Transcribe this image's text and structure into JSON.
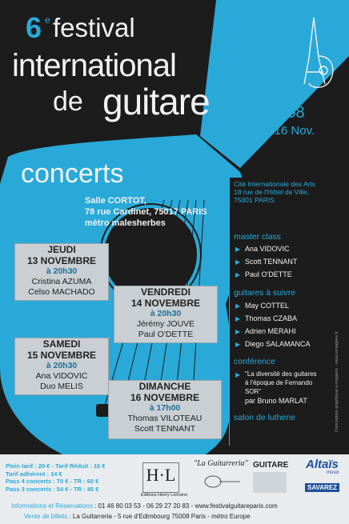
{
  "title": {
    "number": "6",
    "superscript": "e",
    "line1": "festival",
    "line2": "international",
    "line3a": "de",
    "line3b": "guitare"
  },
  "event": {
    "city_year": "Paris 2008",
    "dates": "du 13 au 16 Nov."
  },
  "concerts": {
    "heading": "concerts",
    "venue_line1": "Salle CORTOT,",
    "venue_line2": "78 rue Cardinet, 75017 PARIS",
    "venue_line3": "métro malesherbes",
    "items": [
      {
        "day": "JEUDI",
        "date": "13 NOVEMBRE",
        "time": "à 20h30",
        "artist1": "Cristina AZUMA",
        "artist2": "Celso MACHADO"
      },
      {
        "day": "VENDREDI",
        "date": "14 NOVEMBRE",
        "time": "à 20h30",
        "artist1": "Jérémy JOUVE",
        "artist2": "Paul O'DETTE"
      },
      {
        "day": "SAMEDI",
        "date": "15 NOVEMBRE",
        "time": "à 20h30",
        "artist1": "Ana VIDOVIC",
        "artist2": "Duo MELIS"
      },
      {
        "day": "DIMANCHE",
        "date": "16 NOVEMBRE",
        "time": "à 17h00",
        "artist1": "Thomas VILOTEAU",
        "artist2": "Scott TENNANT"
      }
    ]
  },
  "panel": {
    "venue_line1": "Cité Internationale des Arts",
    "venue_line2": "18 rue de l'Hôtel de Ville,",
    "venue_line3": "75001 PARIS",
    "masterclass_heading": "master class",
    "masterclass": [
      "Ana VIDOVIC",
      "Scott TENNANT",
      "Paul O'DETTE"
    ],
    "guitaristes_heading": "guitares à suivre",
    "guitaristes": [
      "May COTTEL",
      "Thomas CZABA",
      "Adrien MERAHI",
      "Diego SALAMANCA"
    ],
    "conference_heading": "conférence",
    "conference_line1": "\"La diversité des guitares",
    "conference_line2": "à l'époque de Fernando",
    "conference_line3": "SOR\"",
    "conference_speaker": "par Bruno MARLAT",
    "salon_heading": "salon de lutherie",
    "credit": "Conception graphique e-magiere · www.emagiere.fr"
  },
  "prices": {
    "line1": "Plein tarif : 20 € - Tarif Réduit : 16 €",
    "line2": "Tarif adhérent : 14 €",
    "line3": "Pass 4 concerts : 70 € - TR : 60 €",
    "line4": "Pass 3 concerts : 54 € - TR : 45 €"
  },
  "sponsors": {
    "editions": "Editions Henry Lemoine",
    "guitarreria": "\"La Guitarreria\"",
    "guitare_mag": "GUITARE",
    "altais": "Altaïs",
    "altais_sub": "music",
    "savarez": "SAVAREZ"
  },
  "footer": {
    "info_label": "Informations et Réservations",
    "info_text": " : 01 46 80 03 53 - 06 29 27 20 83 - www.festivalguitareparis.com",
    "vente_label": "Vente de billets",
    "vente_text": " : La Guitarreria - 5 rue d'Edimbourg 75008 Paris - métro Europe"
  },
  "colors": {
    "background": "#1c1c1c",
    "accent": "#29a9d8",
    "band": "#e9ecee"
  }
}
